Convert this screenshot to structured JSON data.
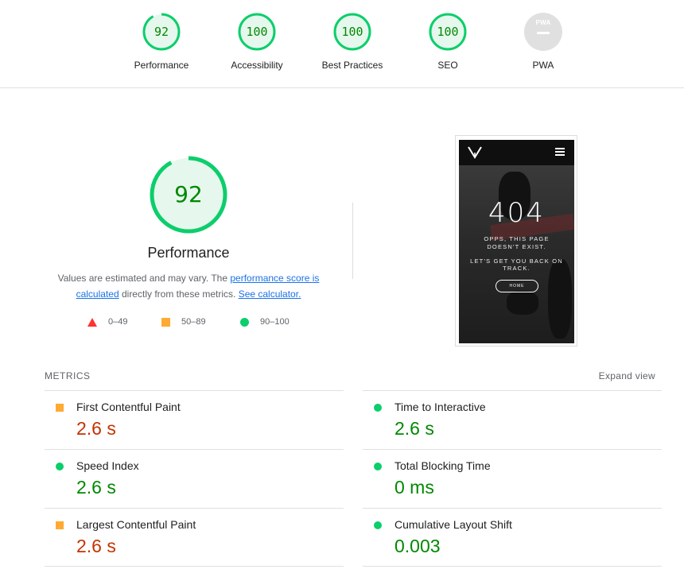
{
  "categories": [
    {
      "score": "92",
      "label": "Performance",
      "fraction": 0.92
    },
    {
      "score": "100",
      "label": "Accessibility",
      "fraction": 1.0
    },
    {
      "score": "100",
      "label": "Best Practices",
      "fraction": 1.0
    },
    {
      "score": "100",
      "label": "SEO",
      "fraction": 1.0
    },
    {
      "label": "PWA",
      "badge_text": "PWA"
    }
  ],
  "performance": {
    "score": "92",
    "fraction": 0.92,
    "title": "Performance",
    "desc_1": "Values are estimated and may vary. The ",
    "desc_link_1": "performance score is calculated",
    "desc_2": " directly from these metrics. ",
    "desc_link_2": "See calculator.",
    "legend": [
      "0–49",
      "50–89",
      "90–100"
    ]
  },
  "screenshot": {
    "title": "404",
    "line1": "OPPS, THIS PAGE",
    "line2": "DOESN'T EXIST.",
    "line3": "LET'S GET YOU BACK ON",
    "line4": "TRACK.",
    "button": "HOME"
  },
  "metrics": {
    "heading": "METRICS",
    "expand": "Expand view",
    "items": [
      {
        "name": "First Contentful Paint",
        "value": "2.6 s",
        "status": "average"
      },
      {
        "name": "Time to Interactive",
        "value": "2.6 s",
        "status": "pass"
      },
      {
        "name": "Speed Index",
        "value": "2.6 s",
        "status": "pass"
      },
      {
        "name": "Total Blocking Time",
        "value": "0 ms",
        "status": "pass"
      },
      {
        "name": "Largest Contentful Paint",
        "value": "2.6 s",
        "status": "average"
      },
      {
        "name": "Cumulative Layout Shift",
        "value": "0.003",
        "status": "pass"
      }
    ]
  },
  "colors": {
    "pass": "#0cce6b",
    "pass_text": "#008800",
    "average": "#ffaa33",
    "average_text": "#c33300",
    "fail": "#ff3333",
    "link": "#1a73e8"
  }
}
